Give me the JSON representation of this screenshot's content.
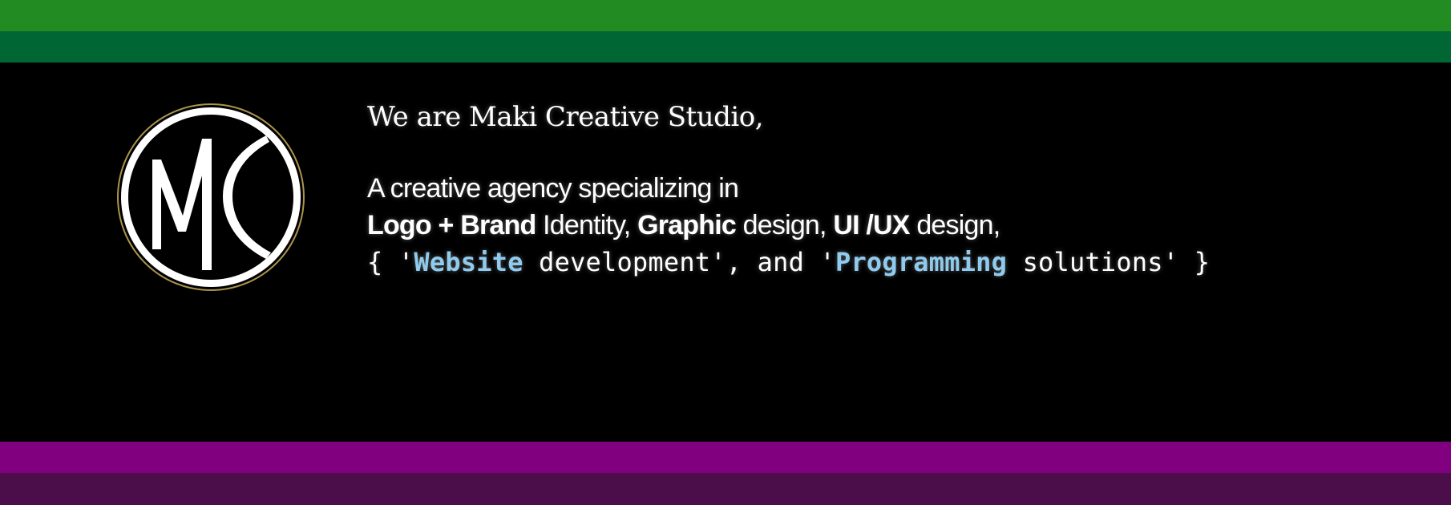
{
  "colors": {
    "stripe_top_1": "#228B22",
    "stripe_top_2": "#006633",
    "stripe_bottom_1": "#800080",
    "stripe_bottom_2": "#4B0E4B",
    "background": "#000000",
    "text": "#FFFFFF",
    "code_highlight": "#8FCBEF"
  },
  "logo": {
    "icon": "mc-monogram-logo",
    "letters": "MC"
  },
  "headline": {
    "greeting": "We are Maki Creative Studio,"
  },
  "services": {
    "intro": "A creative agency specializing in",
    "logo_brand": "Logo + Brand",
    "identity": " Identity, ",
    "graphic": "Graphic",
    "graphic_rest": " design, ",
    "uiux": "UI /UX",
    "uiux_rest": " design,"
  },
  "code_line": {
    "open": "{ '",
    "website": "Website",
    "middle": " development', and '",
    "programming": "Programming",
    "close": " solutions' }"
  }
}
